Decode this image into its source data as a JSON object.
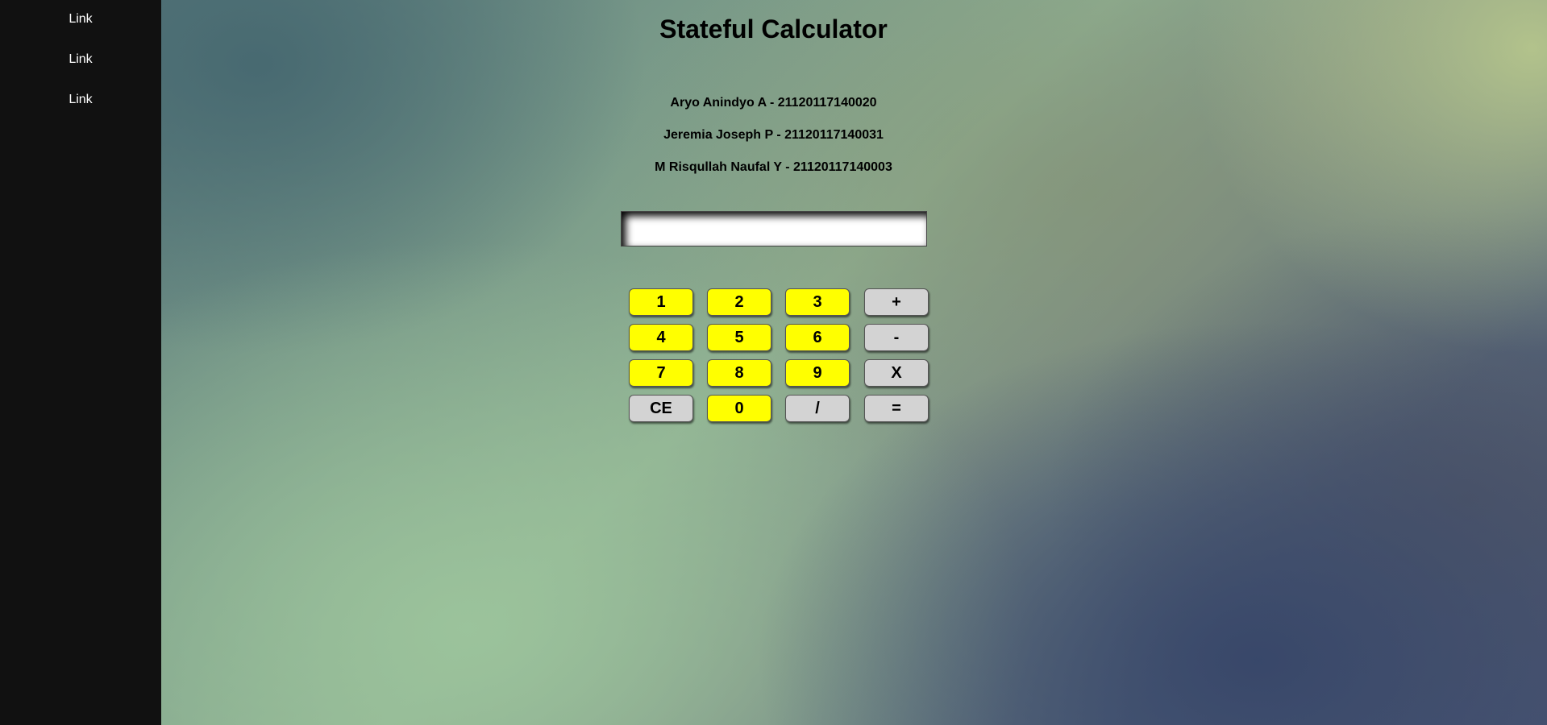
{
  "sidebar": {
    "links": [
      "Link",
      "Link",
      "Link"
    ]
  },
  "header": {
    "title": "Stateful Calculator"
  },
  "members": [
    "Aryo Anindyo A - 21120117140020",
    "Jeremia Joseph P - 21120117140031",
    "M Risqullah Naufal Y - 21120117140003"
  ],
  "display": {
    "value": ""
  },
  "keypad": {
    "rows": [
      [
        "1",
        "2",
        "3",
        "+"
      ],
      [
        "4",
        "5",
        "6",
        "-"
      ],
      [
        "7",
        "8",
        "9",
        "X"
      ],
      [
        "CE",
        "0",
        "/",
        "="
      ]
    ]
  },
  "colors": {
    "sidebar_bg": "#111111",
    "number_key_bg": "#ffff00",
    "operator_key_bg": "#d3d3d3"
  }
}
